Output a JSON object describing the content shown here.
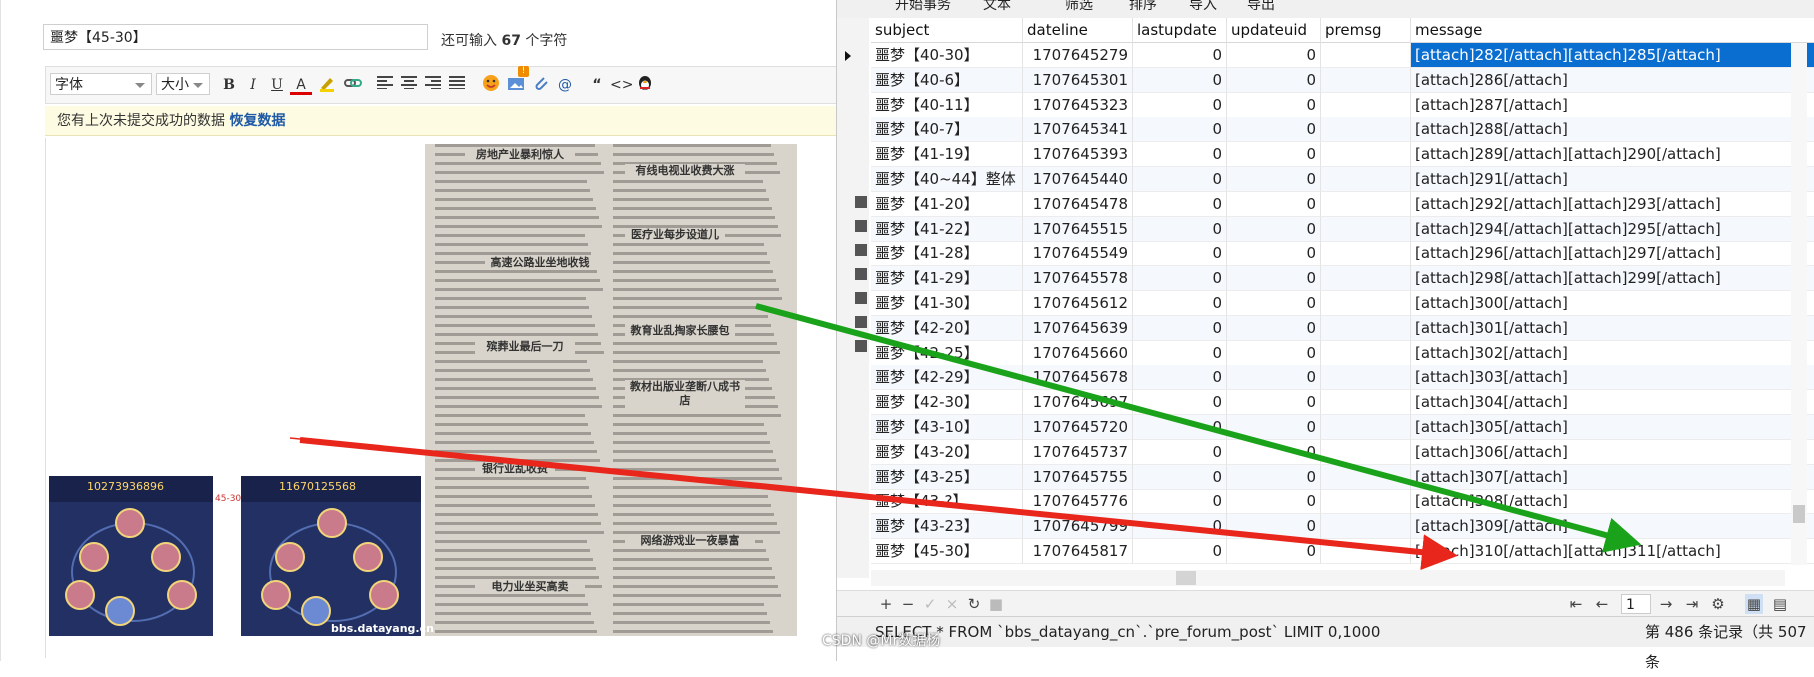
{
  "editor": {
    "subject_value": "噩梦【45-30】",
    "hint_prefix": "还可输入",
    "hint_count": "67",
    "hint_suffix": "个字符",
    "font_select": "字体",
    "size_select": "大小",
    "toolbar_bold": "B",
    "toolbar_italic": "I",
    "toolbar_underline": "U",
    "toolbar_forecolor": "A",
    "toolbar_quote": "“",
    "toolbar_code": "<>",
    "toolbar_at": "@",
    "toolbar_badge": "!",
    "restore_text": "您有上次未提交成功的数据",
    "restore_link": "恢复数据",
    "image1_score": "10273936896",
    "image2_score": "11670125568",
    "image_label": "45-30",
    "image_watermark": "bbs.datayang.cn",
    "newspaper_headlines": [
      "房地产业暴利惊人",
      "有线电视业收费大涨",
      "高速公路业坐地收钱",
      "医疗业每步设道儿",
      "殡葬业最后一刀",
      "教育业乱掏家长腰包",
      "教材出版业垄断八成书店",
      "银行业乱收费",
      "网络游戏业一夜暴富",
      "电力业坐买高卖"
    ]
  },
  "db": {
    "menu_items": [
      "开始事务",
      "文本",
      "筛选",
      "排序",
      "导入",
      "导出"
    ],
    "columns": [
      "subject",
      "dateline",
      "lastupdate",
      "updateuid",
      "premsg",
      "message"
    ],
    "rows": [
      {
        "subject": "噩梦【40-30】",
        "dateline": "1707645279",
        "lastupdate": "0",
        "updateuid": "0",
        "premsg": "",
        "message": "[attach]282[/attach][attach]285[/attach]"
      },
      {
        "subject": "噩梦【40-6】",
        "dateline": "1707645301",
        "lastupdate": "0",
        "updateuid": "0",
        "premsg": "",
        "message": "[attach]286[/attach]"
      },
      {
        "subject": "噩梦【40-11】",
        "dateline": "1707645323",
        "lastupdate": "0",
        "updateuid": "0",
        "premsg": "",
        "message": "[attach]287[/attach]"
      },
      {
        "subject": "噩梦【40-7】",
        "dateline": "1707645341",
        "lastupdate": "0",
        "updateuid": "0",
        "premsg": "",
        "message": "[attach]288[/attach]"
      },
      {
        "subject": "噩梦【41-19】",
        "dateline": "1707645393",
        "lastupdate": "0",
        "updateuid": "0",
        "premsg": "",
        "message": "[attach]289[/attach][attach]290[/attach]"
      },
      {
        "subject": "噩梦【40~44】整体",
        "dateline": "1707645440",
        "lastupdate": "0",
        "updateuid": "0",
        "premsg": "",
        "message": "[attach]291[/attach]"
      },
      {
        "subject": "噩梦【41-20】",
        "dateline": "1707645478",
        "lastupdate": "0",
        "updateuid": "0",
        "premsg": "",
        "message": "[attach]292[/attach][attach]293[/attach]"
      },
      {
        "subject": "噩梦【41-22】",
        "dateline": "1707645515",
        "lastupdate": "0",
        "updateuid": "0",
        "premsg": "",
        "message": "[attach]294[/attach][attach]295[/attach]"
      },
      {
        "subject": "噩梦【41-28】",
        "dateline": "1707645549",
        "lastupdate": "0",
        "updateuid": "0",
        "premsg": "",
        "message": "[attach]296[/attach][attach]297[/attach]"
      },
      {
        "subject": "噩梦【41-29】",
        "dateline": "1707645578",
        "lastupdate": "0",
        "updateuid": "0",
        "premsg": "",
        "message": "[attach]298[/attach][attach]299[/attach]"
      },
      {
        "subject": "噩梦【41-30】",
        "dateline": "1707645612",
        "lastupdate": "0",
        "updateuid": "0",
        "premsg": "",
        "message": "[attach]300[/attach]"
      },
      {
        "subject": "噩梦【42-20】",
        "dateline": "1707645639",
        "lastupdate": "0",
        "updateuid": "0",
        "premsg": "",
        "message": "[attach]301[/attach]"
      },
      {
        "subject": "噩梦【42-25】",
        "dateline": "1707645660",
        "lastupdate": "0",
        "updateuid": "0",
        "premsg": "",
        "message": "[attach]302[/attach]"
      },
      {
        "subject": "噩梦【42-29】",
        "dateline": "1707645678",
        "lastupdate": "0",
        "updateuid": "0",
        "premsg": "",
        "message": "[attach]303[/attach]"
      },
      {
        "subject": "噩梦【42-30】",
        "dateline": "1707645697",
        "lastupdate": "0",
        "updateuid": "0",
        "premsg": "",
        "message": "[attach]304[/attach]"
      },
      {
        "subject": "噩梦【43-10】",
        "dateline": "1707645720",
        "lastupdate": "0",
        "updateuid": "0",
        "premsg": "",
        "message": "[attach]305[/attach]"
      },
      {
        "subject": "噩梦【43-20】",
        "dateline": "1707645737",
        "lastupdate": "0",
        "updateuid": "0",
        "premsg": "",
        "message": "[attach]306[/attach]"
      },
      {
        "subject": "噩梦【43-25】",
        "dateline": "1707645755",
        "lastupdate": "0",
        "updateuid": "0",
        "premsg": "",
        "message": "[attach]307[/attach]"
      },
      {
        "subject": "噩梦【43-?】",
        "dateline": "1707645776",
        "lastupdate": "0",
        "updateuid": "0",
        "premsg": "",
        "message": "[attach]308[/attach]"
      },
      {
        "subject": "噩梦【43-23】",
        "dateline": "1707645799",
        "lastupdate": "0",
        "updateuid": "0",
        "premsg": "",
        "message": "[attach]309[/attach]"
      },
      {
        "subject": "噩梦【45-30】",
        "dateline": "1707645817",
        "lastupdate": "0",
        "updateuid": "0",
        "premsg": "",
        "message": "[attach]310[/attach][attach]311[/attach]"
      }
    ],
    "selected_row": 0,
    "page_number": "1",
    "sql": "SELECT * FROM `bbs_datayang_cn`.`pre_forum_post` LIMIT 0,1000",
    "record_count": "第 486 条记录（共 507 条",
    "watermark": "CSDN @Mr数据杨"
  },
  "colors": {
    "arrow_green": "#1aa31a",
    "arrow_red": "#e8261b",
    "selection": "#0a6ed1",
    "restore_bg": "#fefbe3"
  }
}
